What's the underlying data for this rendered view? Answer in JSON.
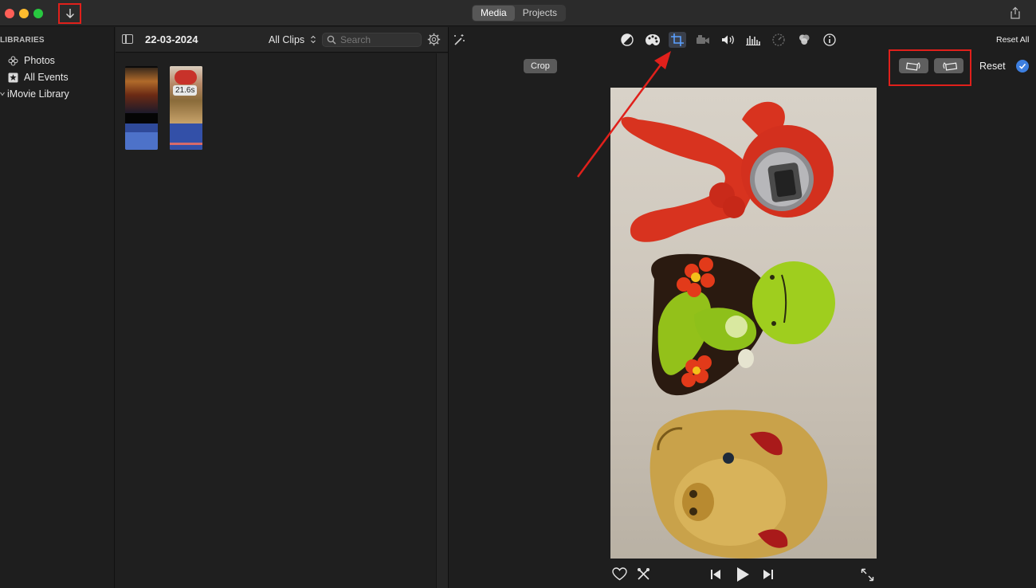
{
  "titlebar": {
    "tabs": [
      {
        "label": "Media",
        "active": true
      },
      {
        "label": "Projects",
        "active": false
      }
    ],
    "import_icon": "arrow-down-icon",
    "share_icon": "share-icon"
  },
  "sidebar": {
    "heading": "LIBRARIES",
    "items": [
      {
        "label": "Photos",
        "icon": "photos-icon"
      },
      {
        "label": "All Events",
        "icon": "star-icon"
      },
      {
        "label": "iMovie Library",
        "icon": "chevron-down-icon"
      }
    ]
  },
  "browser": {
    "event_title": "22-03-2024",
    "filter": "All Clips",
    "search_placeholder": "Search",
    "clips": [
      {
        "duration": ""
      },
      {
        "duration": "21.6s"
      }
    ]
  },
  "viewer": {
    "reset_all": "Reset All",
    "active_tool": "crop",
    "tools": [
      "magic-wand-icon",
      "color-balance-icon",
      "color-correction-icon",
      "crop-icon",
      "stabilization-icon",
      "volume-icon",
      "equalizer-icon",
      "speed-icon",
      "filters-icon",
      "info-icon"
    ],
    "crop_label": "Crop",
    "reset_label": "Reset",
    "annotation_color": "#e0201b",
    "accent_color": "#3d7fe0"
  }
}
